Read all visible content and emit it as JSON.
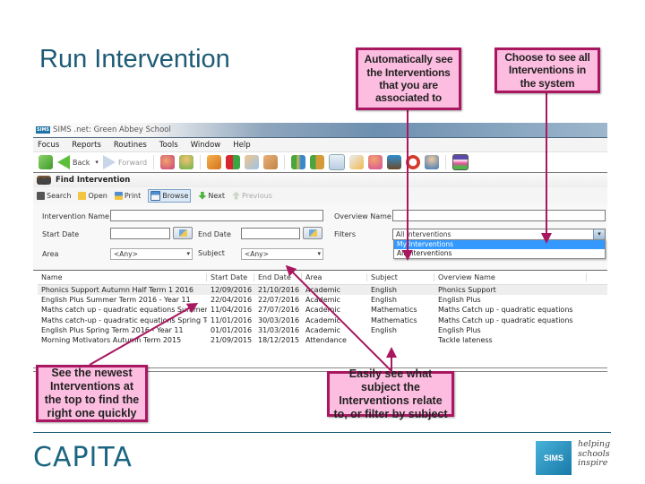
{
  "slide": {
    "title": "Run Intervention",
    "callouts": {
      "auto_see": "Automatically see the Interventions that you are associated to",
      "choose_all": "Choose to see all Interventions in the system",
      "newest": "See the newest Interventions at the top to find the right one quickly",
      "subject": "Easily see what subject the Interventions relate to, or filter by subject"
    },
    "accent_color": "#a8175f",
    "callout_fill": "#fdbde0"
  },
  "window": {
    "app_badge": "SIMS",
    "title": "SIMS .net: Green Abbey School",
    "menu": [
      "Focus",
      "Reports",
      "Routines",
      "Tools",
      "Window",
      "Help"
    ],
    "nav": {
      "back": "Back",
      "forward": "Forward"
    },
    "toolbar_icons": [
      "people-icon",
      "person-icon",
      "book-icon",
      "flag-icon",
      "message-icon",
      "door-icon",
      "books-icon",
      "dog-books-icon",
      "notes-icon",
      "edit-icon",
      "person-badge-icon",
      "home-up-icon",
      "clock-icon",
      "user-key-icon",
      "chart-icon"
    ]
  },
  "pane": {
    "title": "Find Intervention",
    "actions": {
      "search": "Search",
      "open": "Open",
      "print": "Print",
      "browse": "Browse",
      "next": "Next",
      "previous": "Previous"
    },
    "form": {
      "intervention_name_label": "Intervention Name",
      "intervention_name_value": "",
      "overview_name_label": "Overview Name",
      "overview_name_value": "",
      "start_date_label": "Start Date",
      "start_date_value": "",
      "end_date_label": "End Date",
      "end_date_value": "",
      "filters_label": "Filters",
      "filters_value": "All Interventions",
      "filters_options": [
        "My Interventions",
        "All Interventions"
      ],
      "area_label": "Area",
      "area_value": "<Any>",
      "subject_label": "Subject",
      "subject_value": "<Any>"
    },
    "grid": {
      "columns": [
        "Name",
        "Start Date",
        "End Date",
        "Area",
        "Subject",
        "Overview Name"
      ],
      "rows": [
        [
          "Phonics Support Autumn Half Term 1 2016",
          "12/09/2016",
          "21/10/2016",
          "Academic",
          "English",
          "Phonics Support"
        ],
        [
          "English Plus Summer Term 2016 - Year 11",
          "22/04/2016",
          "22/07/2016",
          "Academic",
          "English",
          "English Plus"
        ],
        [
          "Maths catch up - quadratic equations Summer Te",
          "11/04/2016",
          "27/07/2016",
          "Academic",
          "Mathematics",
          "Maths Catch up - quadratic equations"
        ],
        [
          "Maths catch-up - quadratic equations Spring Term",
          "11/01/2016",
          "30/03/2016",
          "Academic",
          "Mathematics",
          "Maths Catch up - quadratic equations"
        ],
        [
          "English Plus Spring Term 2016 - Year 11",
          "01/01/2016",
          "31/03/2016",
          "Academic",
          "English",
          "English Plus"
        ],
        [
          "Morning Motivators Autumn Term 2015",
          "21/09/2015",
          "18/12/2015",
          "Attendance",
          "",
          "Tackle lateness"
        ]
      ]
    }
  },
  "footer": {
    "brand": "CAPITA",
    "sims_logo": "SIMS",
    "tagline": [
      "helping",
      "schools",
      "inspire"
    ]
  }
}
